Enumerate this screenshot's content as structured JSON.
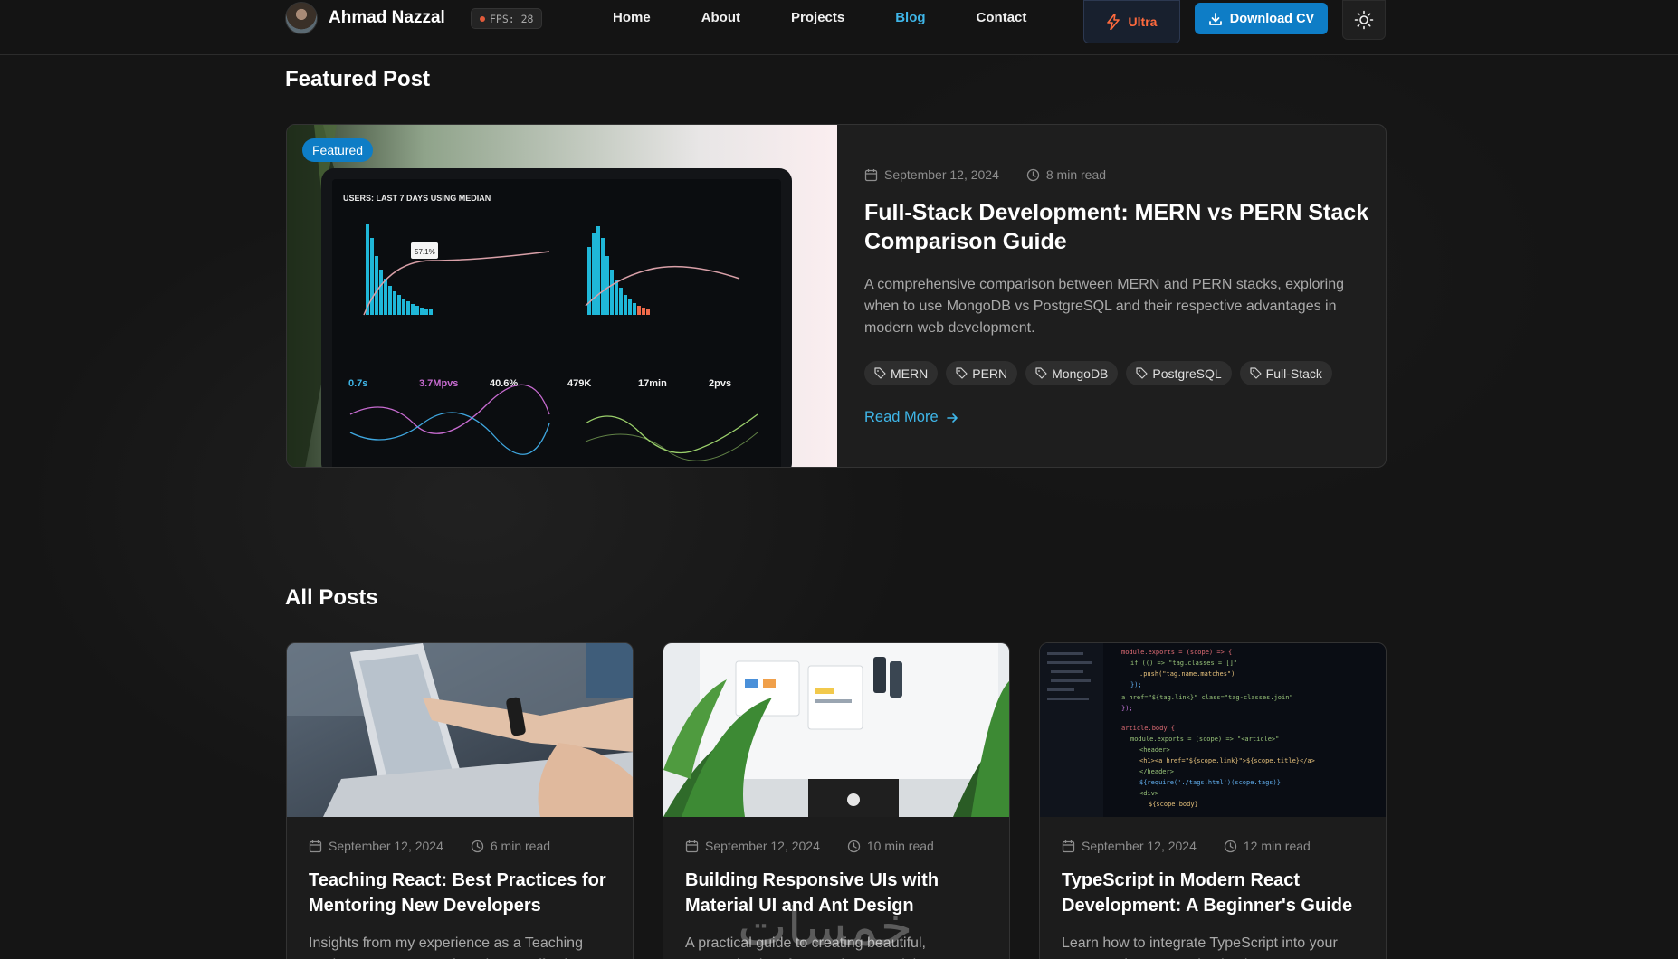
{
  "nav": {
    "brand": "Ahmad Nazzal",
    "fps": "FPS: 28",
    "links": [
      "Home",
      "About",
      "Projects",
      "Blog",
      "Contact"
    ],
    "active": "Blog",
    "ultra": "Ultra",
    "download": "Download CV"
  },
  "featured": {
    "heading": "Featured Post",
    "badge": "Featured",
    "date": "September 12, 2024",
    "read_time": "8 min read",
    "title": "Full-Stack Development: MERN vs PERN Stack Comparison Guide",
    "description": "A comprehensive comparison between MERN and PERN stacks, exploring when to use MongoDB vs PostgreSQL and their respective advantages in modern web development.",
    "tags": [
      "MERN",
      "PERN",
      "MongoDB",
      "PostgreSQL",
      "Full-Stack"
    ],
    "read_more": "Read More",
    "image_text": {
      "header": "USERS: LAST 7 DAYS USING MEDIAN",
      "tooltip": "57.1%",
      "stat1": "0.7s",
      "stat2": "3.7Mpvs",
      "stat3": "40.6%",
      "stat4": "479K",
      "stat5": "17min",
      "stat6": "2pvs"
    }
  },
  "all_posts": {
    "heading": "All Posts",
    "posts": [
      {
        "date": "September 12, 2024",
        "read_time": "6 min read",
        "title": "Teaching React: Best Practices for Mentoring New Developers",
        "description": "Insights from my experience as a Teaching Assistant at MERAKI, focusing on effective"
      },
      {
        "date": "September 12, 2024",
        "read_time": "10 min read",
        "title": "Building Responsive UIs with Material UI and Ant Design",
        "description": "A practical guide to creating beautiful, responsive interfaces using Material UI"
      },
      {
        "date": "September 12, 2024",
        "read_time": "12 min read",
        "title": "TypeScript in Modern React Development: A Beginner's Guide",
        "description": "Learn how to integrate TypeScript into your React projects, covering basic types"
      }
    ]
  },
  "watermark": "خمسات",
  "colors": {
    "background": "#151515",
    "accent": "#0e7dc6",
    "link": "#3fb6e8",
    "ultra": "#ff6a3d"
  }
}
